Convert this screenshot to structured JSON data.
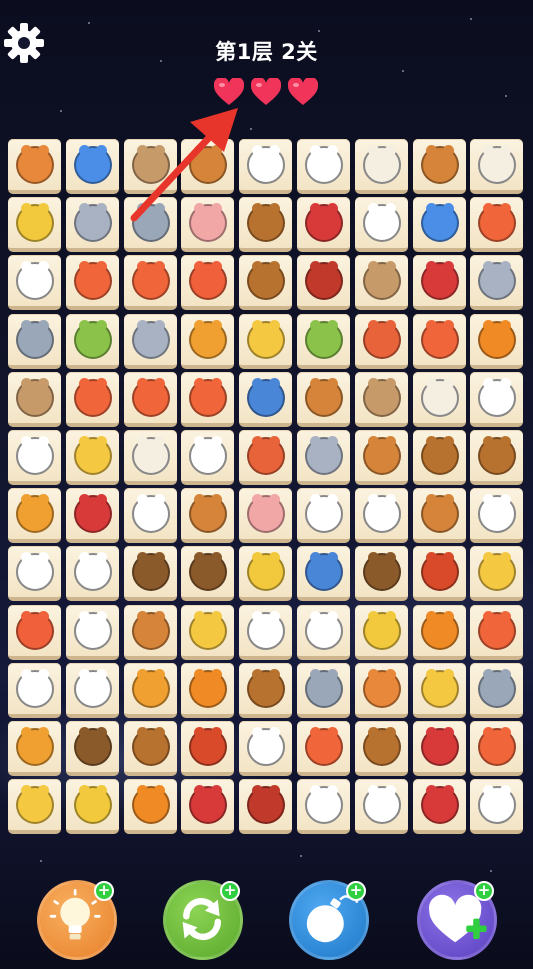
{
  "header": {
    "level_text": "第1层 2关",
    "lives": 3
  },
  "colors": {
    "heart": "#f0345a",
    "arrow": "#e8352b",
    "tile": "#f6ead0"
  },
  "icons": {
    "settings": "gear-icon",
    "life": "heart-icon",
    "pointer": "arrow-icon"
  },
  "board": {
    "rows": 12,
    "cols": 9,
    "tiles": [
      [
        "raccoon",
        "cat",
        "monkey",
        "horse",
        "rabbit",
        "rabbit",
        "sheep",
        "horse",
        "sheep"
      ],
      [
        "giraffe",
        "mouse",
        "elephant",
        "pig",
        "bull",
        "gorilla",
        "panda",
        "cat",
        "fox"
      ],
      [
        "rabbit",
        "fox",
        "fox",
        "fish",
        "bull",
        "boar",
        "monkey",
        "gorilla",
        "mouse"
      ],
      [
        "elephant",
        "parrot",
        "mouse",
        "tiger",
        "leopard",
        "parrot",
        "squirrel",
        "fox",
        "lion"
      ],
      [
        "monkey",
        "fox",
        "fox",
        "fox",
        "rhino",
        "horse",
        "monkey",
        "sheep",
        "rabbit"
      ],
      [
        "hen",
        "leopard",
        "sheep",
        "rabbit",
        "squirrel",
        "mouse",
        "horse",
        "bull",
        "bull"
      ],
      [
        "tiger",
        "gorilla",
        "hen",
        "horse",
        "pig",
        "rabbit",
        "cow",
        "horse",
        "panda"
      ],
      [
        "panda",
        "rabbit",
        "bear",
        "bear",
        "giraffe",
        "rhino",
        "bear",
        "hedgehog",
        "leopard"
      ],
      [
        "fish",
        "cow",
        "horse",
        "leopard",
        "rabbit",
        "rabbit",
        "giraffe",
        "lion",
        "fox"
      ],
      [
        "rabbit",
        "panda",
        "tiger",
        "lion",
        "bull",
        "elephant",
        "raccoon",
        "leopard",
        "elephant"
      ],
      [
        "tiger",
        "bear",
        "bull",
        "hedgehog",
        "panda",
        "fox",
        "bull",
        "gorilla",
        "fox"
      ],
      [
        "leopard",
        "giraffe",
        "lion",
        "gorilla",
        "boar",
        "rabbit",
        "panda",
        "gorilla",
        "rabbit"
      ]
    ]
  },
  "animal_colors": {
    "raccoon": "#e8883a",
    "cat": "#4a8ee8",
    "monkey": "#c79a6a",
    "horse": "#d5843a",
    "rabbit": "#ffffff",
    "sheep": "#f5efe2",
    "giraffe": "#f2c93c",
    "mouse": "#a9b2c2",
    "elephant": "#9aa7b8",
    "pig": "#f2a7a7",
    "bull": "#b8722f",
    "gorilla": "#d83a3a",
    "panda": "#ffffff",
    "fox": "#f0653a",
    "fish": "#f0603a",
    "boar": "#c0392b",
    "parrot": "#8bc34a",
    "tiger": "#f0a030",
    "leopard": "#f5c842",
    "squirrel": "#e8633a",
    "lion": "#f08a25",
    "rhino": "#4a86d8",
    "hen": "#ffffff",
    "cow": "#ffffff",
    "bear": "#8b5a2b",
    "hedgehog": "#d84a2a"
  },
  "powerups": [
    {
      "name": "hint",
      "icon": "lightbulb-icon",
      "color": "#f0923a"
    },
    {
      "name": "shuffle",
      "icon": "refresh-icon",
      "color": "#6cb83a"
    },
    {
      "name": "bomb",
      "icon": "bomb-icon",
      "color": "#2b8ad8"
    },
    {
      "name": "extra-life",
      "icon": "heart-plus-icon",
      "color": "#6b4fcf"
    }
  ]
}
